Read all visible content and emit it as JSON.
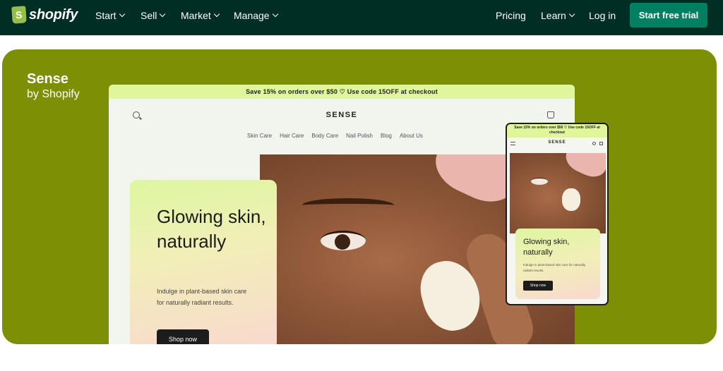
{
  "topnav": {
    "logo_text": "shopify",
    "menu": [
      {
        "label": "Start"
      },
      {
        "label": "Sell"
      },
      {
        "label": "Market"
      },
      {
        "label": "Manage"
      }
    ],
    "right": {
      "pricing": "Pricing",
      "learn": "Learn",
      "login": "Log in",
      "cta": "Start free trial"
    }
  },
  "theme": {
    "name": "Sense",
    "by": "by Shopify"
  },
  "desktop_preview": {
    "banner": "Save 15% on orders over $50 ♡ Use code 15OFF at checkout",
    "brand": "SENSE",
    "menu": [
      "Skin Care",
      "Hair Care",
      "Body Care",
      "Nail Polish",
      "Blog",
      "About Us"
    ],
    "card": {
      "title": "Glowing skin, naturally",
      "subtitle": "Indulge in plant-based skin care for naturally radiant results.",
      "button": "Shop now"
    }
  },
  "mobile_preview": {
    "banner": "Save 15% on orders over $50 ♡ Use code 15OFF at checkout",
    "brand": "SENSE",
    "card": {
      "title": "Glowing skin, naturally",
      "subtitle": "Indulge in plant-based skin care for naturally radiant results.",
      "button": "Shop now"
    }
  },
  "colors": {
    "nav_bg": "#002e25",
    "cta_bg": "#008060",
    "hero_bg": "#7c8f05",
    "banner_bg": "#dff79a"
  }
}
